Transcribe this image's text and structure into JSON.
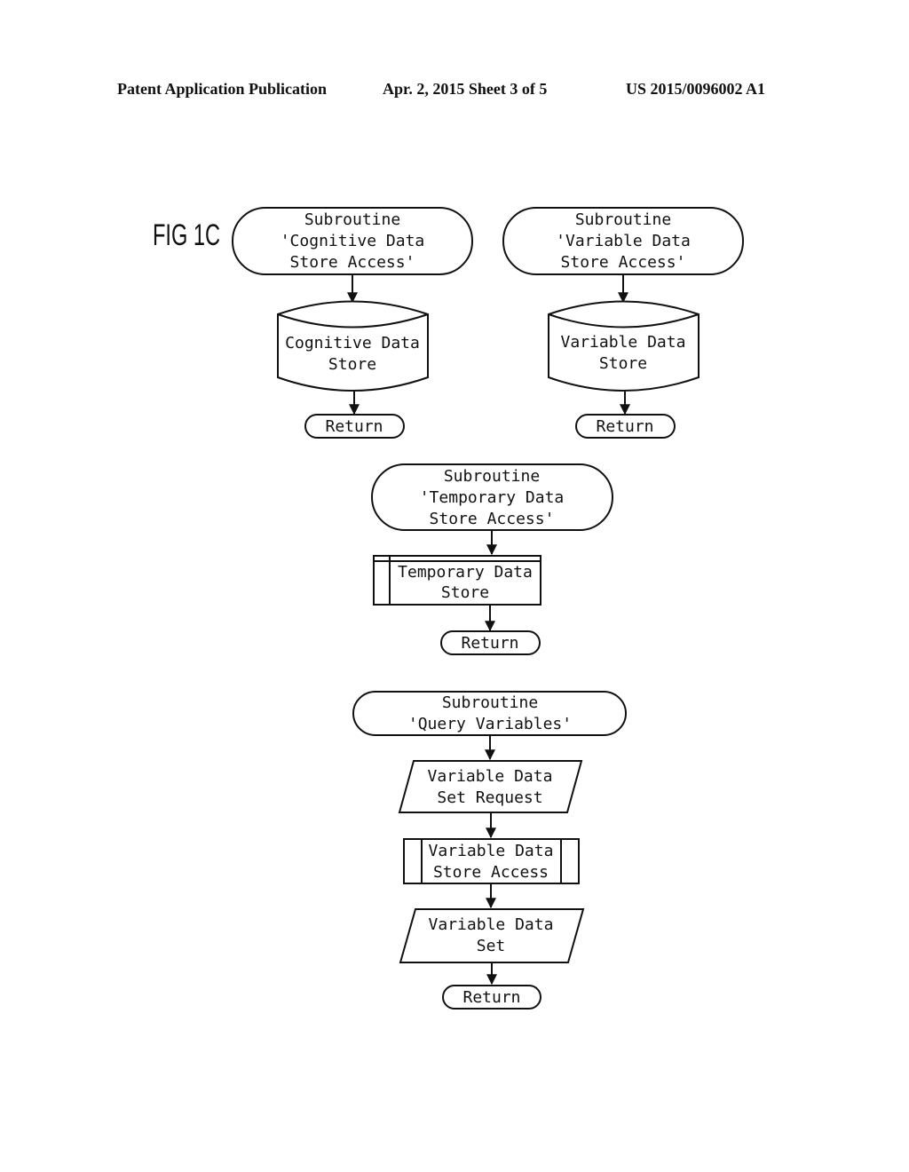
{
  "header": {
    "publication": "Patent Application Publication",
    "date_sheet": "Apr. 2, 2015   Sheet 3 of 5",
    "patent_number": "US 2015/0096002 A1"
  },
  "figure_label": "FIG 1C",
  "flowcharts": [
    {
      "name": "cognitive-data-store-access",
      "start": [
        "Subroutine",
        "'Cognitive Data",
        "Store Access'"
      ],
      "store": [
        "Cognitive Data",
        "Store"
      ],
      "end": "Return"
    },
    {
      "name": "variable-data-store-access",
      "start": [
        "Subroutine",
        "'Variable Data",
        "Store Access'"
      ],
      "store": [
        "Variable Data",
        "Store"
      ],
      "end": "Return"
    },
    {
      "name": "temporary-data-store-access",
      "start": [
        "Subroutine",
        "'Temporary Data",
        "Store Access'"
      ],
      "store": [
        "Temporary Data",
        "Store"
      ],
      "end": "Return"
    },
    {
      "name": "query-variables",
      "start": [
        "Subroutine",
        "'Query Variables'"
      ],
      "input": [
        "Variable Data",
        "Set Request"
      ],
      "process": [
        "Variable Data",
        "Store Access"
      ],
      "output": [
        "Variable Data",
        "Set"
      ],
      "end": "Return"
    }
  ]
}
